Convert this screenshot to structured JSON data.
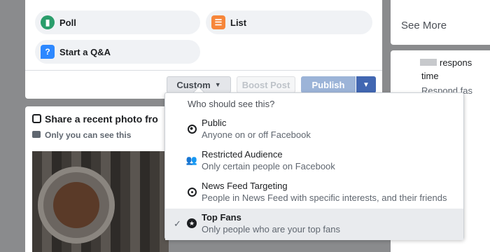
{
  "composer": {
    "poll_label": "Poll",
    "list_label": "List",
    "qa_label": "Start a Q&A",
    "custom_label": "Custom",
    "boost_label": "Boost Post",
    "publish_label": "Publish"
  },
  "share_card": {
    "title": "Share a recent photo fro",
    "subtitle": "Only you can see this"
  },
  "right_col": {
    "see_more": "See More",
    "resp_line1": "respons",
    "resp_line2": "time",
    "resp_line3": "Respond fas"
  },
  "audience_dropdown": {
    "header": "Who should see this?",
    "options": [
      {
        "label": "Public",
        "description": "Anyone on or off Facebook",
        "icon": "globe-icon",
        "selected": false
      },
      {
        "label": "Restricted Audience",
        "description": "Only certain people on Facebook",
        "icon": "people-icon",
        "selected": false
      },
      {
        "label": "News Feed Targeting",
        "description": "People in News Feed with specific interests, and their friends",
        "icon": "target-icon",
        "selected": false
      },
      {
        "label": "Top Fans",
        "description": "Only people who are your top fans",
        "icon": "star-circle-icon",
        "selected": true
      }
    ]
  },
  "colors": {
    "brand_blue": "#4267b2",
    "publish_disabled": "#9cb4d8"
  }
}
